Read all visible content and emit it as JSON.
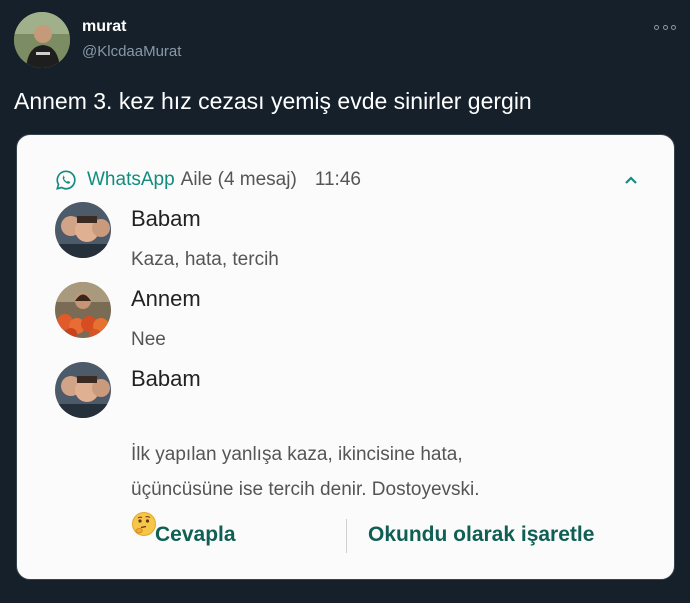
{
  "tweet": {
    "user_name": "murat",
    "user_handle": "@KlcdaaMurat",
    "text": "Annem 3. kez hız cezası yemiş evde sinirler gergin"
  },
  "notification": {
    "app_name": "WhatsApp",
    "group": "Aile (4 mesaj)",
    "time": "11:46",
    "messages": [
      {
        "sender": "Babam",
        "text": "Kaza, hata, tercih"
      },
      {
        "sender": "Annem",
        "text": "Nee"
      },
      {
        "sender": "Babam",
        "text": "İlk yapılan yanlışa kaza, ikincisine hata,\nüçüncüsüne ise tercih denir. Dostoyevski.",
        "emoji": "thinking-face"
      }
    ],
    "actions": {
      "reply": "Cevapla",
      "mark_read": "Okundu olarak işaretle"
    }
  },
  "colors": {
    "background": "#15202b",
    "card": "#fbfbfb",
    "whatsapp_green": "#128c7e",
    "action_text": "#0f5f55"
  }
}
